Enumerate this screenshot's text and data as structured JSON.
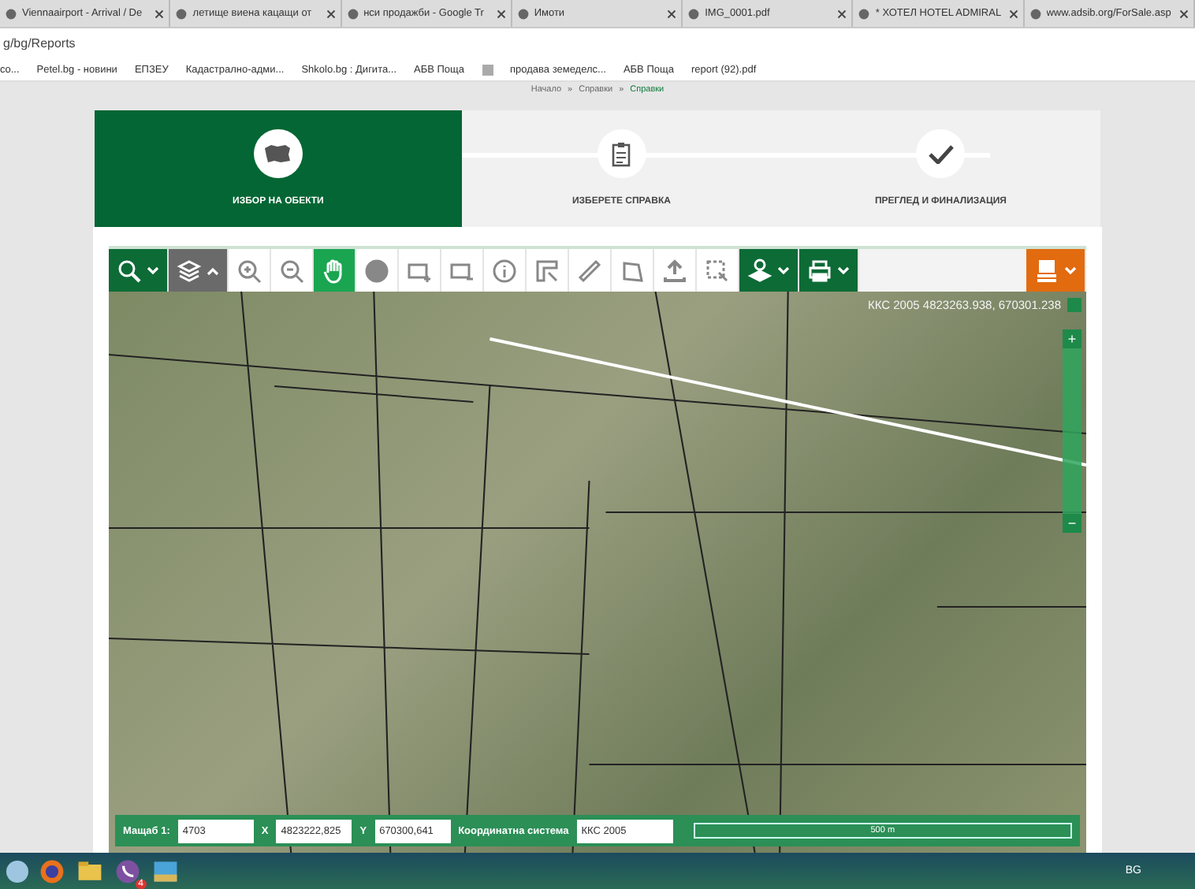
{
  "browser": {
    "tabs": [
      {
        "title": "Viennaairport - Arrival / De",
        "selected": false
      },
      {
        "title": "летище виена кацащи от",
        "selected": false
      },
      {
        "title": "нси продажби - Google Tr",
        "selected": false
      },
      {
        "title": "Имоти",
        "selected": false
      },
      {
        "title": "IMG_0001.pdf",
        "selected": false
      },
      {
        "title": "* ХОТЕЛ HOTEL ADMIRAL",
        "selected": false
      },
      {
        "title": "www.adsib.org/ForSale.asp",
        "selected": false
      }
    ],
    "address": "g/bg/Reports",
    "bookmarks": [
      {
        "kind": "link",
        "label": "co..."
      },
      {
        "kind": "link",
        "label": "Petel.bg - новини"
      },
      {
        "kind": "link",
        "label": "ЕПЗЕУ"
      },
      {
        "kind": "link",
        "label": "Кадастрално-адми..."
      },
      {
        "kind": "link",
        "label": "Shkolo.bg : Дигита..."
      },
      {
        "kind": "link",
        "label": "АБВ Поща"
      },
      {
        "kind": "icon"
      },
      {
        "kind": "link",
        "label": "продава земеделс..."
      },
      {
        "kind": "link",
        "label": "АБВ Поща"
      },
      {
        "kind": "link",
        "label": "report (92).pdf"
      }
    ]
  },
  "breadcrumb": [
    {
      "label": "Начало",
      "selected": false
    },
    {
      "label": "Справки",
      "selected": false
    },
    {
      "label": "Справки",
      "selected": true
    }
  ],
  "breadcrumb_separator": "»",
  "steps": [
    {
      "label": "ИЗБОР НА ОБЕКТИ",
      "selected": true
    },
    {
      "label": "ИЗБЕРЕТЕ СПРАВКА",
      "selected": false
    },
    {
      "label": "ПРЕГЛЕД И ФИНАЛИЗАЦИЯ",
      "selected": false
    }
  ],
  "toolbar": [
    {
      "kind": "dark-menu",
      "expanded": false,
      "selected": false
    },
    {
      "kind": "grey-menu",
      "expanded": true,
      "selected": false
    },
    {
      "kind": "tool",
      "selected": false
    },
    {
      "kind": "tool",
      "selected": false
    },
    {
      "kind": "tool",
      "selected": true
    },
    {
      "kind": "tool",
      "selected": false
    },
    {
      "kind": "tool",
      "selected": false
    },
    {
      "kind": "tool",
      "selected": false
    },
    {
      "kind": "tool",
      "selected": false
    },
    {
      "kind": "tool",
      "selected": false
    },
    {
      "kind": "tool",
      "selected": false
    },
    {
      "kind": "tool",
      "selected": false
    },
    {
      "kind": "tool",
      "selected": false
    },
    {
      "kind": "tool",
      "selected": false
    },
    {
      "kind": "dark-menu",
      "expanded": false,
      "selected": false
    },
    {
      "kind": "dark-menu",
      "expanded": false,
      "selected": false
    },
    {
      "kind": "orange-menu",
      "expanded": false,
      "selected": false
    }
  ],
  "map": {
    "coordinates": "ККС 2005 4823263.938, 670301.238",
    "zoom_in": "+",
    "zoom_out": "−",
    "scale_label": "500 m",
    "footer": {
      "scale_label": "Мащаб 1:",
      "scale_value": "4703",
      "x_label": "X",
      "x_value": "4823222,825",
      "y_label": "Y",
      "y_value": "670300,641",
      "system_label": "Координатна система",
      "system_value": "ККС 2005"
    }
  },
  "taskbar": {
    "viber_badge": "4",
    "language": "BG"
  }
}
